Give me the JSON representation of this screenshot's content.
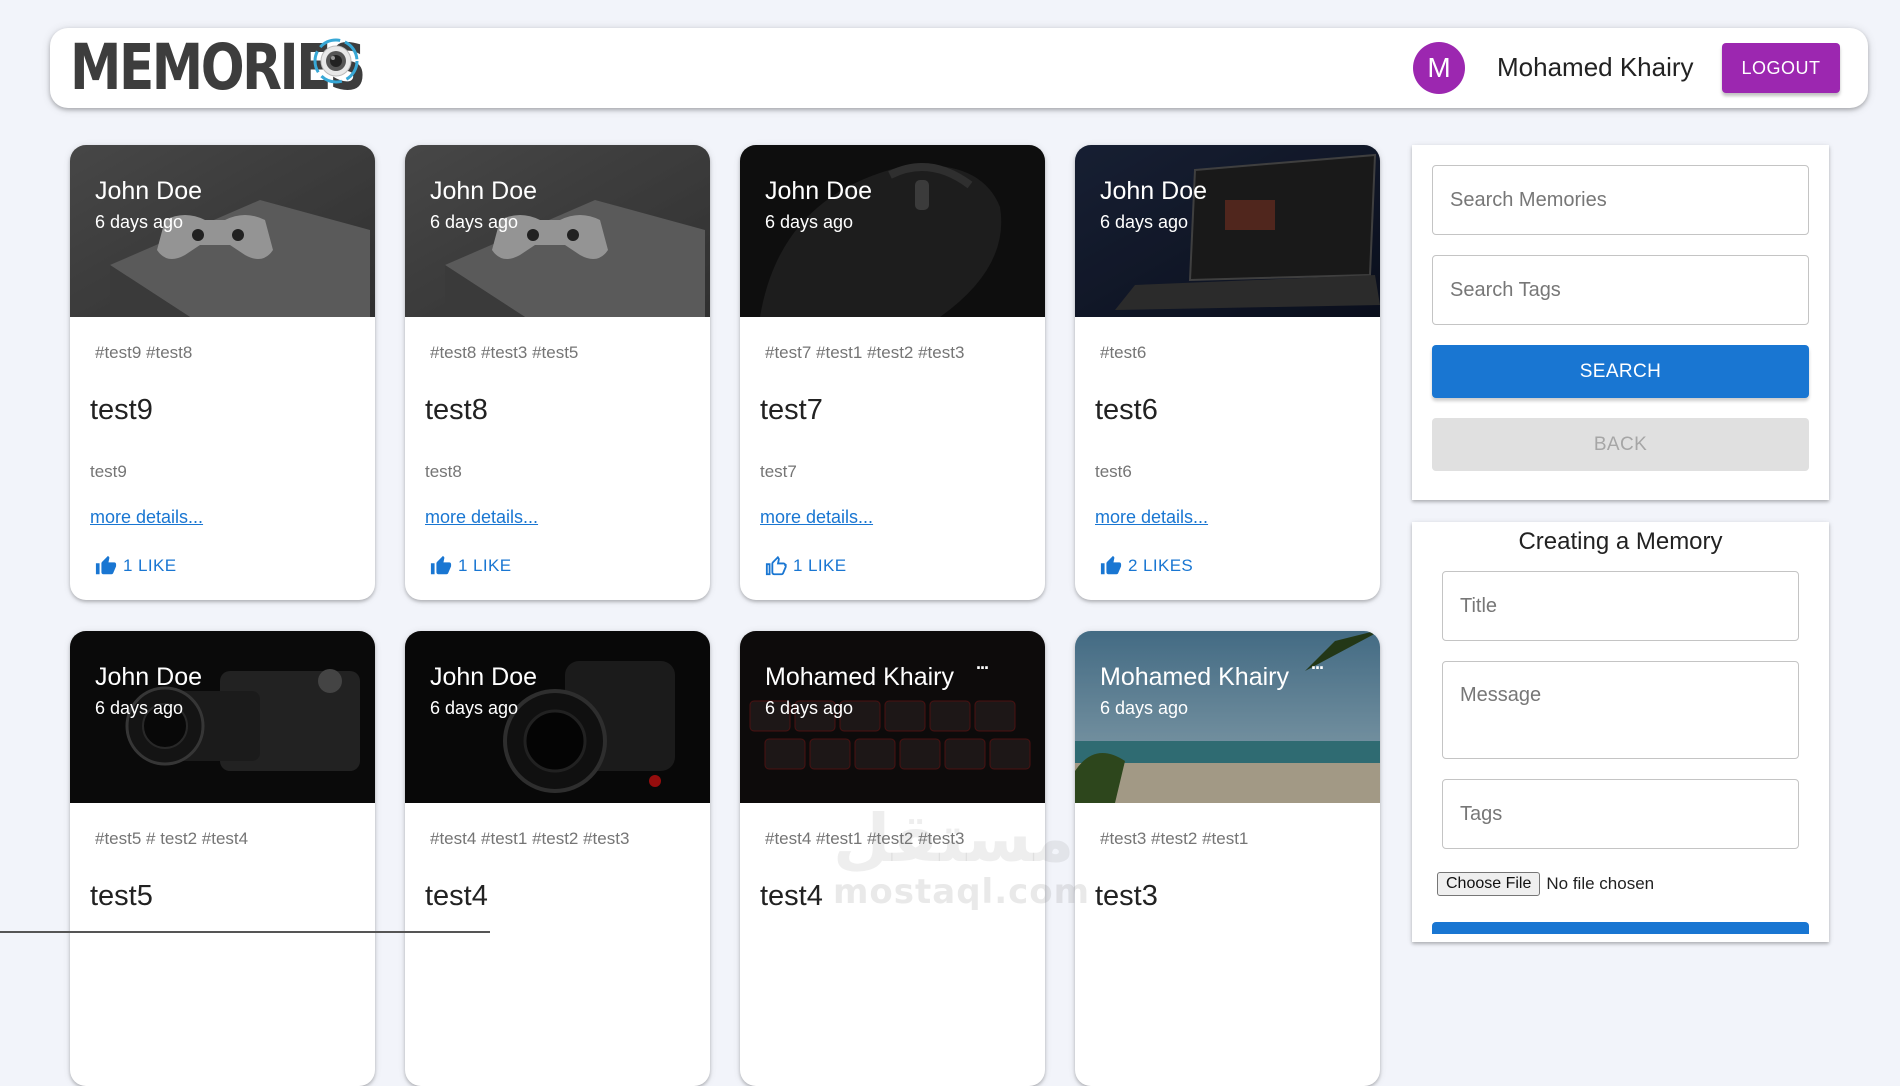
{
  "header": {
    "brand": "MEMORIES",
    "avatar_letter": "M",
    "user_name": "Mohamed Khairy",
    "logout_label": "LOGOUT"
  },
  "colors": {
    "primary": "#1976d2",
    "secondary": "#9c27b0",
    "background": "#f2f4fa"
  },
  "posts": [
    {
      "author": "John Doe",
      "time": "6 days ago",
      "tags": "#test9 #test8",
      "title": "test9",
      "message": "test9",
      "link": "more details...",
      "likes": "1 LIKE",
      "image": "game-console",
      "owner_menu": ""
    },
    {
      "author": "John Doe",
      "time": "6 days ago",
      "tags": "#test8 #test3 #test5",
      "title": "test8",
      "message": "test8",
      "link": "more details...",
      "likes": "1 LIKE",
      "image": "game-console",
      "owner_menu": ""
    },
    {
      "author": "John Doe",
      "time": "6 days ago",
      "tags": "#test7 #test1 #test2 #test3",
      "title": "test7",
      "message": "test7",
      "link": "more details...",
      "likes": "1 LIKE",
      "image": "mouse",
      "owner_menu": ""
    },
    {
      "author": "John Doe",
      "time": "6 days ago",
      "tags": "#test6",
      "title": "test6",
      "message": "test6",
      "link": "more details...",
      "likes": "2 LIKES",
      "image": "laptop",
      "owner_menu": ""
    },
    {
      "author": "John Doe",
      "time": "6 days ago",
      "tags": "#test5 # test2 #test4",
      "title": "test5",
      "message": "",
      "link": "",
      "likes": "",
      "image": "camera",
      "owner_menu": ""
    },
    {
      "author": "John Doe",
      "time": "6 days ago",
      "tags": "#test4 #test1 #test2 #test3",
      "title": "test4",
      "message": "",
      "link": "",
      "likes": "",
      "image": "camera-canon",
      "owner_menu": ""
    },
    {
      "author": "Mohamed Khairy",
      "time": "6 days ago",
      "tags": "#test4 #test1 #test2 #test3",
      "title": "test4",
      "message": "",
      "link": "",
      "likes": "",
      "image": "keyboard",
      "owner_menu": "..."
    },
    {
      "author": "Mohamed Khairy",
      "time": "6 days ago",
      "tags": "#test3 #test2 #test1",
      "title": "test3",
      "message": "",
      "link": "",
      "likes": "",
      "image": "beach",
      "owner_menu": "..."
    }
  ],
  "search": {
    "memories_placeholder": "Search Memories",
    "tags_placeholder": "Search Tags",
    "search_label": "SEARCH",
    "back_label": "BACK"
  },
  "form": {
    "title": "Creating a Memory",
    "title_placeholder": "Title",
    "message_placeholder": "Message",
    "tags_placeholder": "Tags",
    "file_button": "Choose File",
    "file_status": "No file chosen"
  },
  "watermark": {
    "arabic": "مستقل",
    "latin": "mostaql.com"
  }
}
